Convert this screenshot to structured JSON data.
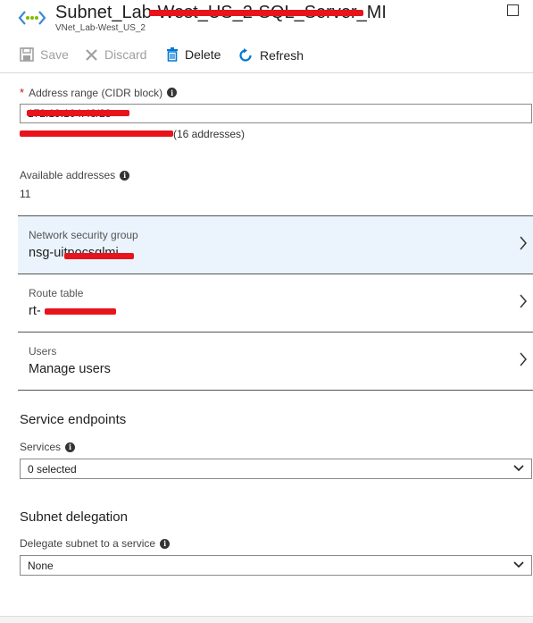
{
  "header": {
    "title": "Subnet_Lab-West_US_2-SQL_Server_MI",
    "subtitle": "VNet_Lab-West_US_2"
  },
  "toolbar": {
    "save_label": "Save",
    "discard_label": "Discard",
    "delete_label": "Delete",
    "refresh_label": "Refresh"
  },
  "address_range": {
    "required_mark": "*",
    "label": "Address range (CIDR block)",
    "value": "172.19.104.48/28",
    "hint_suffix": "(16 addresses)"
  },
  "available_addresses": {
    "label": "Available addresses",
    "value": "11"
  },
  "nsg": {
    "label": "Network security group",
    "value": "nsg-uitpocsqlmi"
  },
  "route_table": {
    "label": "Route table",
    "value": "rt-"
  },
  "users": {
    "label": "Users",
    "value": "Manage users"
  },
  "service_endpoints": {
    "heading": "Service endpoints",
    "services_label": "Services",
    "services_value": "0 selected"
  },
  "subnet_delegation": {
    "heading": "Subnet delegation",
    "delegate_label": "Delegate subnet to a service",
    "delegate_value": "None"
  },
  "colors": {
    "accent": "#0078d4",
    "required": "#c8191e",
    "highlight_row": "#ebf3fc",
    "redaction": "#e8141c"
  },
  "icons": {
    "subnet": "subnet-icon",
    "save": "save-icon",
    "discard": "discard-icon",
    "delete": "trash-icon",
    "refresh": "refresh-icon",
    "info": "info-icon",
    "chevron_right": "chevron-right-icon",
    "chevron_down": "chevron-down-icon",
    "maximize": "maximize-icon"
  }
}
